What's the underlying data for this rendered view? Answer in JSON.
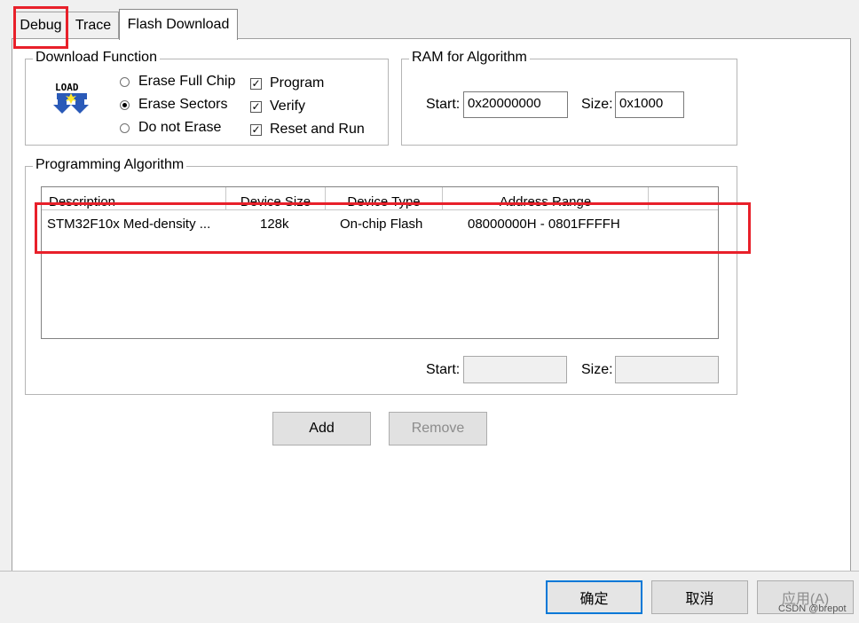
{
  "tabs": [
    {
      "label": "Debug"
    },
    {
      "label": "Trace"
    },
    {
      "label": "Flash Download"
    }
  ],
  "download_function": {
    "title": "Download Function",
    "icon": "load-icon",
    "icon_text": "LOAD",
    "radios": [
      {
        "label": "Erase Full Chip",
        "selected": false
      },
      {
        "label": "Erase Sectors",
        "selected": true
      },
      {
        "label": "Do not Erase",
        "selected": false
      }
    ],
    "checks": [
      {
        "label": "Program",
        "checked": true
      },
      {
        "label": "Verify",
        "checked": true
      },
      {
        "label": "Reset and Run",
        "checked": true
      }
    ]
  },
  "ram": {
    "title": "RAM for Algorithm",
    "start_label": "Start:",
    "start_value": "0x20000000",
    "size_label": "Size:",
    "size_value": "0x1000"
  },
  "programming_algorithm": {
    "title": "Programming Algorithm",
    "columns": [
      "Description",
      "Device Size",
      "Device Type",
      "Address Range"
    ],
    "rows": [
      {
        "description": "STM32F10x Med-density ...",
        "device_size": "128k",
        "device_type": "On-chip Flash",
        "address_range": "08000000H - 0801FFFFH"
      }
    ],
    "start_label": "Start:",
    "start_value": "",
    "size_label": "Size:",
    "size_value": ""
  },
  "buttons": {
    "add": "Add",
    "remove": "Remove"
  },
  "footer": {
    "ok": "确定",
    "cancel": "取消",
    "apply": "应用(A)"
  },
  "watermark": "CSDN @brepot",
  "colors": {
    "highlight": "#e8202a",
    "panel": "#ffffff",
    "dialog_bg": "#f0f0f0"
  }
}
